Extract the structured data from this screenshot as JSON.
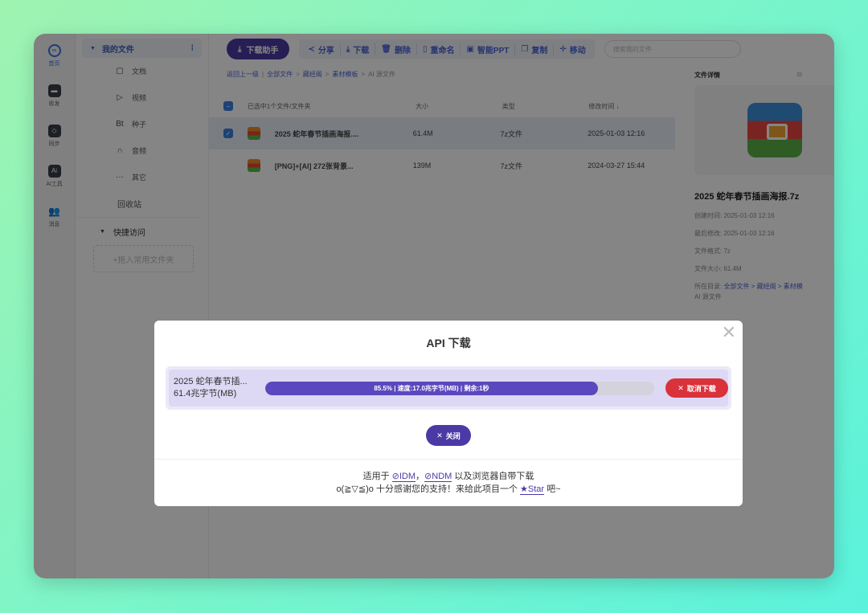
{
  "rail": [
    {
      "label": "首页",
      "icon": "home-icon"
    },
    {
      "label": "收发",
      "icon": "inbox-icon"
    },
    {
      "label": "同步",
      "icon": "sync-icon"
    },
    {
      "label": "AI工具",
      "icon": "ai-icon"
    },
    {
      "label": "消息",
      "icon": "users-icon"
    }
  ],
  "sidebar": {
    "my_files": "我的文件",
    "items": [
      {
        "label": "文档",
        "glyph": "▢"
      },
      {
        "label": "视频",
        "glyph": "▷"
      },
      {
        "label": "种子",
        "glyph": "Bt"
      },
      {
        "label": "音频",
        "glyph": "∩"
      },
      {
        "label": "其它",
        "glyph": "···"
      }
    ],
    "recycle": "回收站",
    "quick": "快捷访问",
    "drop_hint": "+拖入常用文件夹"
  },
  "toolbar": {
    "download_helper": "下载助手",
    "actions": [
      "分享",
      "下载",
      "删除",
      "重命名",
      "智能PPT",
      "复制",
      "移动"
    ],
    "search_placeholder": "搜索我的文件"
  },
  "breadcrumb": {
    "back": "返回上一级",
    "path": [
      "全部文件",
      "藏经阁",
      "素材模板"
    ],
    "current": "AI 源文件"
  },
  "table": {
    "selected_text": "已选中1个文件/文件夹",
    "columns": [
      "大小",
      "类型",
      "修改时间"
    ],
    "rows": [
      {
        "name": "2025 蛇年春节插画海报....",
        "size": "61.4M",
        "type": "7z文件",
        "time": "2025-01-03 12:16",
        "selected": true
      },
      {
        "name": "[PNG]+[AI] 272张背景...",
        "size": "139M",
        "type": "7z文件",
        "time": "2024-03-27 15:44",
        "selected": false
      }
    ]
  },
  "detail": {
    "title": "文件详情",
    "file_name": "2025 蛇年春节插画海报.7z",
    "created": "创建时间: 2025-01-03 12:16",
    "modified": "最后修改: 2025-01-03 12:16",
    "format": "文件格式: 7z",
    "size": "文件大小: 61.4M",
    "location_label": "所在目录:",
    "location_path": "全部文件 > 藏经阁 > 素材模",
    "location_current": "AI 源文件"
  },
  "modal": {
    "title": "API 下载",
    "task_name": "2025 蛇年春节插...",
    "task_size": "61.4兆字节(MB)",
    "progress_percent": 85.5,
    "progress_text": "85.5% | 速度:17.0兆字节(MB) | 剩余:1秒",
    "cancel_label": "取消下载",
    "close_label": "关闭",
    "footer_line1_prefix": "适用于",
    "footer_idm": "IDM",
    "footer_ndm": "NDM",
    "footer_line1_suffix": "以及浏览器自带下载",
    "footer_line2_prefix": "o(≧▽≦)o 十分感谢您的支持！来给此项目一个",
    "footer_star": "★Star",
    "footer_line2_suffix": "吧~"
  },
  "colors": {
    "accent": "#4b3aa6",
    "link": "#4b64d6",
    "danger": "#d9323b",
    "progress_fill": "#5a48be"
  }
}
